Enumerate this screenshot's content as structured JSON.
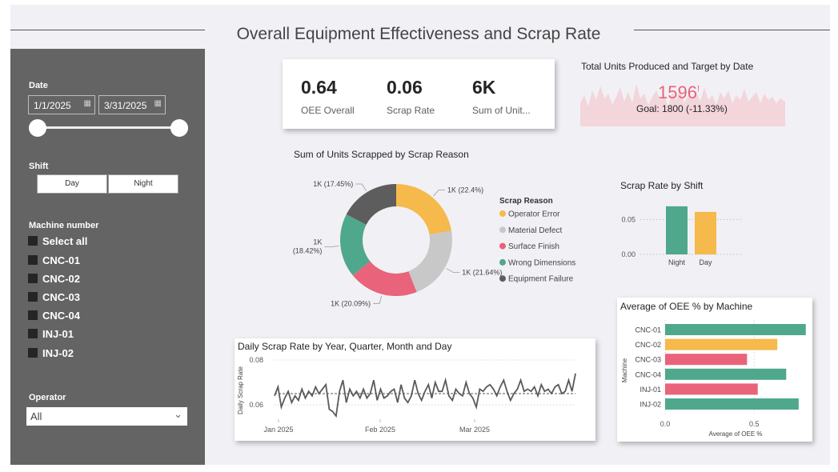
{
  "page": {
    "title": "Overall Equipment Effectiveness and Scrap Rate"
  },
  "colors": {
    "yellow": "#f5b94c",
    "gray": "#c8c8c8",
    "red": "#e9637a",
    "teal": "#4fa88c",
    "dark": "#5d5d5d",
    "sidebar": "#646464"
  },
  "filters": {
    "date": {
      "label": "Date",
      "start": "1/1/2025",
      "end": "3/31/2025",
      "calendar_icon": "calendar-icon"
    },
    "shift": {
      "label": "Shift",
      "options": [
        "Day",
        "Night"
      ]
    },
    "machine": {
      "label": "Machine number",
      "items": [
        "Select all",
        "CNC-01",
        "CNC-02",
        "CNC-03",
        "CNC-04",
        "INJ-01",
        "INJ-02"
      ]
    },
    "operator": {
      "label": "Operator",
      "value": "All"
    }
  },
  "kpis": [
    {
      "value": "0.64",
      "label": "OEE Overall"
    },
    {
      "value": "0.06",
      "label": "Scrap Rate"
    },
    {
      "value": "6K",
      "label": "Sum of Unit..."
    }
  ],
  "units_target": {
    "title": "Total Units Produced and Target by Date",
    "value": "1596",
    "marker": "!",
    "goal": "Goal: 1800 (-11.33%)"
  },
  "chart_data": [
    {
      "type": "pie",
      "title": "Sum of Units Scrapped by Scrap Reason",
      "legend_title": "Scrap Reason",
      "legend_position": "right",
      "labels": [
        "Operator Error",
        "Material Defect",
        "Surface Finish",
        "Wrong Dimensions",
        "Equipment Failure"
      ],
      "values": [
        22.4,
        21.64,
        20.09,
        18.42,
        17.45
      ],
      "data_labels": [
        "1K (22.4%)",
        "1K (21.64%)",
        "1K (20.09%)",
        "1K (18.42%)",
        "1K (17.45%)"
      ]
    },
    {
      "type": "bar",
      "title": "Scrap Rate by Shift",
      "categories": [
        "Night",
        "Day"
      ],
      "values": [
        0.069,
        0.061
      ],
      "ytick_labels": [
        "0.05",
        "0.00"
      ],
      "ylim": [
        0,
        0.07
      ]
    },
    {
      "type": "bar",
      "orientation": "horizontal",
      "title": "Average of OEE % by Machine",
      "categories": [
        "CNC-01",
        "CNC-02",
        "CNC-03",
        "CNC-04",
        "INJ-01",
        "INJ-02"
      ],
      "values": [
        0.79,
        0.63,
        0.46,
        0.68,
        0.52,
        0.75
      ],
      "ylabel": "Machine",
      "xlabel": "Average of OEE %",
      "xtick_labels": [
        "0.0",
        "0.5"
      ],
      "xlim": [
        0,
        0.8
      ]
    },
    {
      "type": "line",
      "title": "Daily Scrap Rate by Year, Quarter, Month and Day",
      "ylabel": "Daily Scrap Rate",
      "ytick_labels": [
        "0.08",
        "0.06"
      ],
      "xtick_labels": [
        "Jan 2025",
        "Feb 2025",
        "Mar 2025"
      ],
      "ylim": [
        0.055,
        0.08
      ],
      "reference_line": 0.065,
      "values": [
        0.064,
        0.068,
        0.059,
        0.063,
        0.066,
        0.061,
        0.064,
        0.062,
        0.067,
        0.063,
        0.066,
        0.064,
        0.068,
        0.065,
        0.067,
        0.069,
        0.058,
        0.057,
        0.055,
        0.066,
        0.071,
        0.061,
        0.067,
        0.064,
        0.066,
        0.063,
        0.067,
        0.063,
        0.065,
        0.071,
        0.062,
        0.067,
        0.063,
        0.064,
        0.066,
        0.067,
        0.061,
        0.069,
        0.063,
        0.061,
        0.064,
        0.071,
        0.065,
        0.062,
        0.066,
        0.069,
        0.063,
        0.07,
        0.066,
        0.066,
        0.071,
        0.064,
        0.062,
        0.067,
        0.065,
        0.064,
        0.07,
        0.065,
        0.063,
        0.059,
        0.067,
        0.066,
        0.068,
        0.069,
        0.067,
        0.064,
        0.068,
        0.071,
        0.066,
        0.062,
        0.065,
        0.067,
        0.071,
        0.066,
        0.067,
        0.066,
        0.068,
        0.064,
        0.069,
        0.066,
        0.067,
        0.065,
        0.068,
        0.069,
        0.065,
        0.066,
        0.071,
        0.066,
        0.074
      ]
    }
  ]
}
